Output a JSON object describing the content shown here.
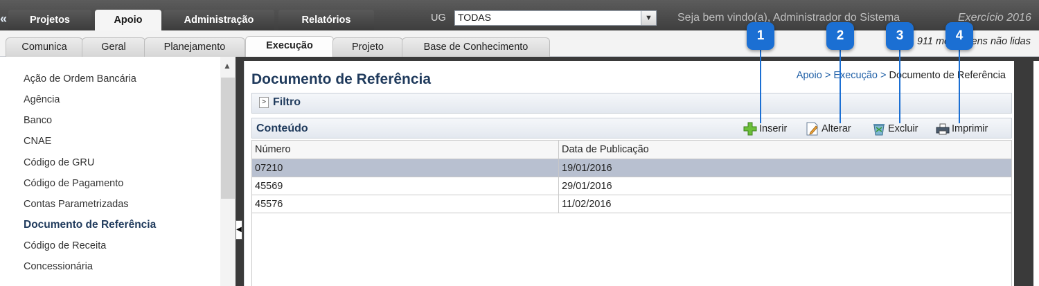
{
  "top_nav": {
    "collapse_icon": "double-chevron-left-icon",
    "tabs": [
      "Projetos",
      "Apoio",
      "Administração",
      "Relatórios"
    ],
    "active_tab": "Apoio",
    "ug_label": "UG",
    "ug_value": "TODAS",
    "welcome": "Seja bem vindo(a), Administrador do Sistema",
    "exercise": "Exercício 2016"
  },
  "sub_nav": {
    "tabs": [
      "Comunica",
      "Geral",
      "Planejamento",
      "Execução",
      "Projeto",
      "Base de Conhecimento"
    ],
    "active_tab": "Execução",
    "unread": "911 mensagens não lidas"
  },
  "sidebar": {
    "items": [
      "Ação de Ordem Bancária",
      "Agência",
      "Banco",
      "CNAE",
      "Código de GRU",
      "Código de Pagamento",
      "Contas Parametrizadas",
      "Documento de Referência",
      "Código de Receita",
      "Concessionária"
    ],
    "active_item": "Documento de Referência"
  },
  "main": {
    "title": "Documento de Referência",
    "breadcrumb": [
      "Apoio",
      "Execução",
      "Documento de Referência"
    ],
    "breadcrumb_sep": ">",
    "filter_label": "Filtro",
    "content_label": "Conteúdo",
    "toolbar": {
      "insert": "Inserir",
      "edit": "Alterar",
      "delete": "Excluir",
      "print": "Imprimir"
    },
    "table": {
      "columns": [
        "Número",
        "Data de Publicação"
      ],
      "rows": [
        [
          "07210",
          "19/01/2016"
        ],
        [
          "45569",
          "29/01/2016"
        ],
        [
          "45576",
          "11/02/2016"
        ]
      ],
      "selected_row": 0
    }
  },
  "callouts": [
    "1",
    "2",
    "3",
    "4"
  ],
  "colors": {
    "accent": "#1b6fd3",
    "title": "#1f3a5c",
    "selected_row": "#b8c0d0",
    "topbar": "#3e3e3e"
  }
}
